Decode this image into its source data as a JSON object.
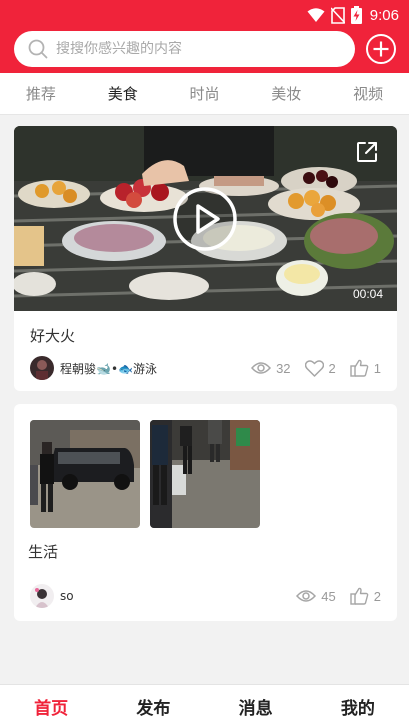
{
  "status_bar": {
    "time": "9:06"
  },
  "header": {
    "search_placeholder": "搜搜你感兴趣的内容",
    "add_icon": "plus-circle-icon"
  },
  "tabs": [
    {
      "label": "推荐",
      "active": false
    },
    {
      "label": "美食",
      "active": true
    },
    {
      "label": "时尚",
      "active": false
    },
    {
      "label": "美妆",
      "active": false
    },
    {
      "label": "视频",
      "active": false
    }
  ],
  "posts": [
    {
      "type": "video",
      "duration": "00:04",
      "title": "好大火",
      "author": "程朝骏🐋•🐟游泳",
      "views": "32",
      "likes": "2",
      "thumbs_up": "1"
    },
    {
      "type": "images",
      "title": "生活",
      "author": "so",
      "views": "45",
      "thumbs_up": "2"
    }
  ],
  "bottom_nav": [
    {
      "label": "首页",
      "active": true
    },
    {
      "label": "发布",
      "active": false
    },
    {
      "label": "消息",
      "active": false
    },
    {
      "label": "我的",
      "active": false
    }
  ],
  "colors": {
    "brand_red": "#f0233a",
    "muted_gray": "#999999"
  }
}
